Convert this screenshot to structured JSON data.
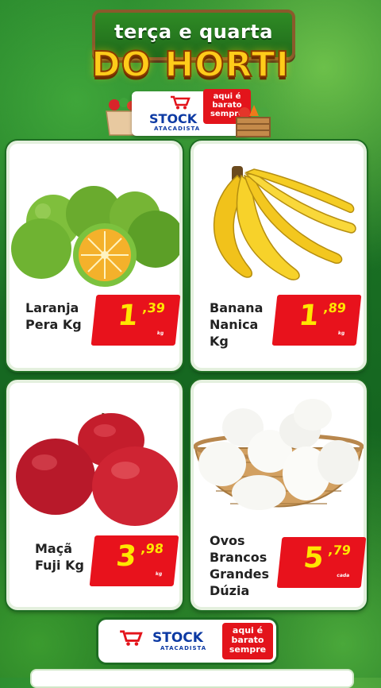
{
  "header": {
    "title_top": "terça e quarta",
    "title_main": "DO HORTI"
  },
  "logo": {
    "brand": "STOCK",
    "brand_sub": "ATACADISTA",
    "tag_line1": "aqui é",
    "tag_line2": "barato",
    "tag_line3": "sempre"
  },
  "products": [
    {
      "name_line1": "Laranja",
      "name_line2": "Pera Kg",
      "price_int": "1",
      "price_dec": ",39",
      "unit": "kg"
    },
    {
      "name_line1": "Banana",
      "name_line2": "Nanica",
      "name_line3": "Kg",
      "price_int": "1",
      "price_dec": ",89",
      "unit": "kg"
    },
    {
      "name_line1": "Maçã",
      "name_line2": "Fuji Kg",
      "price_int": "3",
      "price_dec": ",98",
      "unit": "kg"
    },
    {
      "name_line1": "Ovos",
      "name_line2": "Brancos",
      "name_line3": "Grandes",
      "name_line4": "Dúzia",
      "price_int": "5",
      "price_dec": ",79",
      "unit": "cada"
    }
  ],
  "footer": {
    "brand": "STOCK",
    "brand_sub": "ATACADISTA",
    "tag_line1": "aqui é",
    "tag_line2": "barato",
    "tag_line3": "sempre"
  },
  "colors": {
    "price_bg": "#e8121c",
    "price_text": "#ffe600",
    "brand_blue": "#0d3aa3",
    "title_yellow": "#ffcc1a",
    "background_green": "#1f7a27"
  }
}
